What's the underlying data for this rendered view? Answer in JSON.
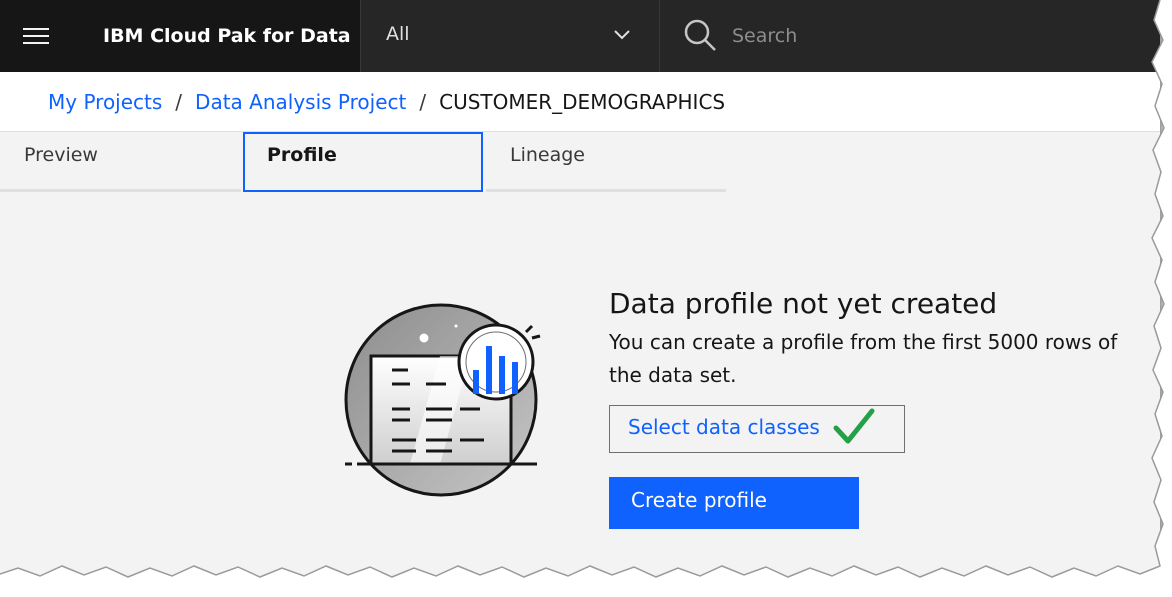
{
  "header": {
    "menu_icon": "hamburger-menu-icon",
    "product_name": "IBM Cloud Pak for Data",
    "scope_select": {
      "value": "All"
    },
    "search": {
      "placeholder": "Search"
    }
  },
  "breadcrumb": {
    "items": [
      {
        "label": "My Projects"
      },
      {
        "label": "Data Analysis Project"
      },
      {
        "label": "CUSTOMER_DEMOGRAPHICS"
      }
    ],
    "separator": "/"
  },
  "tabs": [
    {
      "label": "Preview"
    },
    {
      "label": "Profile",
      "selected": true
    },
    {
      "label": "Lineage"
    }
  ],
  "empty_state": {
    "illustration_icon": "data-profile-illustration-icon",
    "title": "Data profile not yet created",
    "description": "You can create a profile from the first 5000 rows of the data set.",
    "select_classes_label": "Select data classes",
    "create_profile_label": "Create profile"
  },
  "colors": {
    "header_bg": "#262626",
    "accent": "#0f62fe",
    "check": "#24a148",
    "page_bg": "#f3f3f3"
  }
}
